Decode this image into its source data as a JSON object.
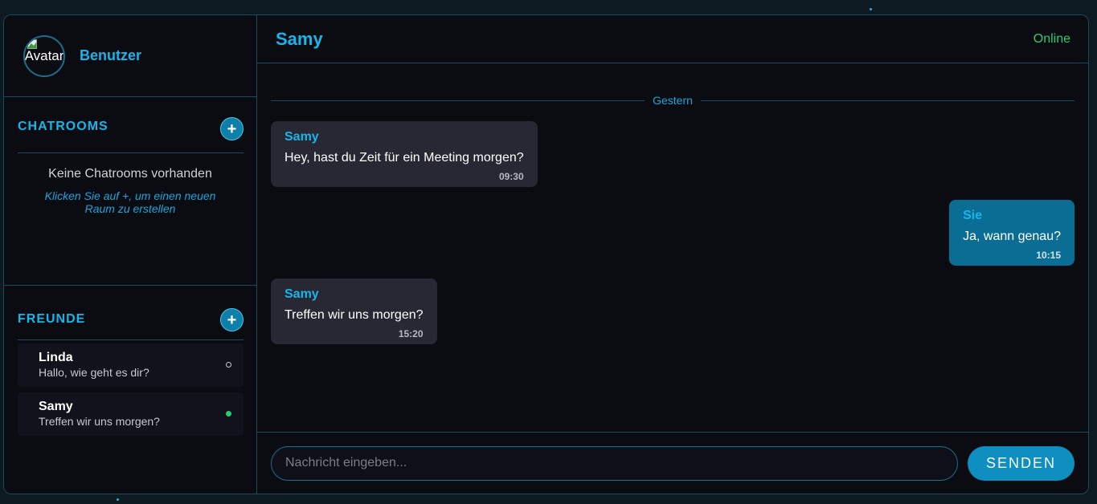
{
  "user": {
    "avatar_alt": "Avatar",
    "name": "Benutzer"
  },
  "chatrooms": {
    "title": "CHATROOMS",
    "add_label": "+",
    "empty_title": "Keine Chatrooms vorhanden",
    "empty_hint": "Klicken Sie auf +, um einen neuen Raum zu erstellen"
  },
  "friends": {
    "title": "FREUNDE",
    "add_label": "+",
    "items": [
      {
        "name": "Linda",
        "last_message": "Hallo, wie geht es dir?",
        "status": "offline"
      },
      {
        "name": "Samy",
        "last_message": "Treffen wir uns morgen?",
        "status": "online"
      }
    ]
  },
  "chat": {
    "name": "Samy",
    "status": "Online",
    "date_divider": "Gestern",
    "messages": [
      {
        "sender": "Samy",
        "text": "Hey, hast du Zeit für ein Meeting morgen?",
        "time": "09:30",
        "direction": "in"
      },
      {
        "sender": "Sie",
        "text": "Ja, wann genau?",
        "time": "10:15",
        "direction": "out"
      },
      {
        "sender": "Samy",
        "text": "Treffen wir uns morgen?",
        "time": "15:20",
        "direction": "in"
      }
    ]
  },
  "composer": {
    "placeholder": "Nachricht eingeben...",
    "send_label": "SENDEN"
  },
  "colors": {
    "accent": "#18b6e8",
    "online": "#2ecc71",
    "outgoing_bubble": "#0a6d94",
    "incoming_bubble": "#282835"
  }
}
